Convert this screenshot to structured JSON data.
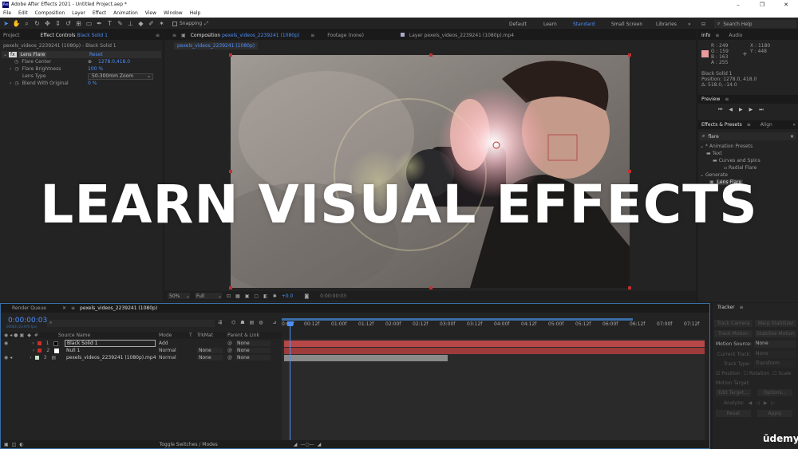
{
  "app": {
    "title": "Adobe After Effects 2021 - Untitled Project.aep *",
    "logo": "Ae",
    "window_controls": [
      "–",
      "❐",
      "✕"
    ]
  },
  "menu": [
    "File",
    "Edit",
    "Composition",
    "Layer",
    "Effect",
    "Animation",
    "View",
    "Window",
    "Help"
  ],
  "toolbar": {
    "snapping_label": "Snapping",
    "workspaces": [
      "Default",
      "Learn",
      "Standard",
      "Small Screen",
      "Libraries"
    ],
    "active_workspace": "Standard",
    "search_help": "Search Help"
  },
  "left_panel": {
    "tab_project": "Project",
    "tab_effect_controls": "Effect Controls",
    "tab_effect_controls_layer": "Black Solid 1",
    "breadcrumb": "pexels_videos_2239241 (1080p) - Black Solid 1",
    "effect_name": "Lens Flare",
    "reset_label": "Reset",
    "properties": [
      {
        "name": "Flare Center",
        "value": "1278.0,418.0"
      },
      {
        "name": "Flare Brightness",
        "value": "100 %"
      },
      {
        "name": "Lens Type",
        "value": "50-300mm Zoom"
      },
      {
        "name": "Blend With Original",
        "value": "0 %"
      }
    ]
  },
  "viewer": {
    "tab_composition": "Composition",
    "tab_composition_name": "pexels_videos_2239241 (1080p)",
    "tab_footage": "Footage (none)",
    "tab_layer": "Layer pexels_videos_2239241 (1080p).mp4",
    "comp_flowchart_tab": "pexels_videos_2239241 (1080p)",
    "overlay_text": "LEARN VISUAL EFFECTS",
    "zoom": "50%",
    "resolution": "Full",
    "exposure": "+0.0",
    "current_time": "0:00:00:03"
  },
  "right_panel": {
    "tab_info": "Info",
    "tab_audio": "Audio",
    "info_rgba": [
      "R : 249",
      "G : 159",
      "B : 163",
      "A : 255"
    ],
    "info_xy": [
      "X : 1180",
      "Y : 448"
    ],
    "info_layer": "Black Solid 1",
    "info_position": "Position: 1278.0, 418.0",
    "info_delta": "Δ: 518.0, -14.0",
    "swatch_color": "#e89a9c",
    "tab_preview": "Preview",
    "tab_effects_presets": "Effects & Presets",
    "tab_align": "Align",
    "search_value": "flare",
    "tree": [
      {
        "label": "* Animation Presets",
        "indent": 0
      },
      {
        "label": "Text",
        "indent": 1
      },
      {
        "label": "Curves and Spins",
        "indent": 2
      },
      {
        "label": "Radial Flare",
        "indent": 3
      },
      {
        "label": "Generate",
        "indent": 0
      },
      {
        "label": "Lens Flare",
        "indent": 1
      }
    ]
  },
  "timeline": {
    "tab_render_queue": "Render Queue",
    "tab_comp": "pexels_videos_2239241 (1080p)",
    "timecode": "0:00:00:03",
    "frames": "00003 (23.976 fps)",
    "columns": {
      "source": "Source Name",
      "mode": "Mode",
      "t": "T",
      "trkmat": "TrkMat",
      "parent": "Parent & Link"
    },
    "layers": [
      {
        "num": "1",
        "name": "Black Solid 1",
        "mode": "Add",
        "trkmat": "",
        "parent": "None",
        "color": "#c9302c",
        "label_color": "#000000"
      },
      {
        "num": "2",
        "name": "Null 1",
        "mode": "Normal",
        "trkmat": "None",
        "parent": "None",
        "color": "#c9302c",
        "label_color": "#ffffff"
      },
      {
        "num": "3",
        "name": "pexels_videos_2239241 (1080p).mp4",
        "mode": "Normal",
        "trkmat": "None",
        "parent": "None",
        "color": "#9a9a9a",
        "label_color": "#c7e1c7"
      }
    ],
    "ruler": [
      "0:00f",
      "00:12f",
      "01:00f",
      "01:12f",
      "02:00f",
      "02:12f",
      "03:00f",
      "03:12f",
      "04:00f",
      "04:12f",
      "05:00f",
      "05:12f",
      "06:00f",
      "06:12f",
      "07:00f",
      "07:12f"
    ],
    "footer_label": "Toggle Switches / Modes"
  },
  "tracker": {
    "title": "Tracker",
    "buttons": [
      "Track Camera",
      "Warp Stabilizer",
      "Track Motion",
      "Stabilize Motion"
    ],
    "motion_source_label": "Motion Source:",
    "motion_source_value": "None",
    "current_track_label": "Current Track:",
    "current_track_value": "None",
    "track_type_label": "Track Type:",
    "track_type_value": "Transform",
    "checks": [
      "Position",
      "Rotation",
      "Scale"
    ],
    "motion_target": "Motion Target:",
    "edit_target": "Edit Target...",
    "options": "Options...",
    "analyze": "Analyze:",
    "reset": "Reset",
    "apply": "Apply"
  },
  "watermark": "ūdemy"
}
